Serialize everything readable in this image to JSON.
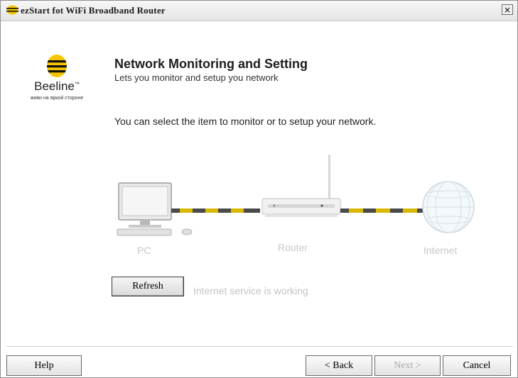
{
  "window": {
    "title": "ezStart fot WiFi Broadband Router",
    "close_label": "×"
  },
  "logo": {
    "name": "Beeline",
    "trademark": "™",
    "tagline": "живи на яркой стороне"
  },
  "header": {
    "title": "Network Monitoring and Setting",
    "subtitle": "Lets you monitor and setup you network"
  },
  "main": {
    "instruction": "You can select the item to monitor or to setup your network.",
    "diagram": {
      "pc_label": "PC",
      "router_label": "Router",
      "internet_label": "Internet"
    },
    "refresh_label": "Refresh",
    "status_text": "Internet service is working"
  },
  "footer": {
    "help_label": "Help",
    "back_label": "< Back",
    "next_label": "Next >",
    "cancel_label": "Cancel"
  },
  "colors": {
    "beeline_yellow": "#f7c600",
    "beeline_black": "#111111",
    "cable_yellow": "#d9b800",
    "cable_dark": "#4a4a4a",
    "disabled_text": "#a9a9a9"
  }
}
